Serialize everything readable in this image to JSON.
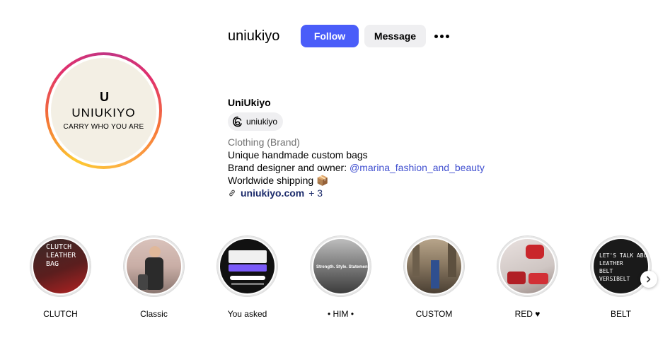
{
  "profile": {
    "username": "uniukiyo",
    "follow_label": "Follow",
    "message_label": "Message",
    "more_icon": "more-options-icon",
    "full_name": "UniUkiyo",
    "threads_handle": "uniukiyo",
    "category": "Clothing (Brand)",
    "bio_line1": "Unique handmade custom bags",
    "bio_line2_prefix": "Brand designer and owner: ",
    "bio_mention": "@marina_fashion_and_beauty",
    "bio_line3": "Worldwide shipping 📦",
    "link_text": "uniukiyo.com",
    "link_more": "+ 3"
  },
  "avatar": {
    "mark": "U",
    "name": "UNIUKIYO",
    "tagline": "CARRY WHO YOU ARE"
  },
  "highlights": [
    {
      "label": "CLUTCH",
      "overlay": "CLUTCH\nLEATHER\nBAG"
    },
    {
      "label": "Classic",
      "overlay": ""
    },
    {
      "label": "You asked",
      "overlay": ""
    },
    {
      "label": "• HIM •",
      "overlay": "Strength. Style. Statement."
    },
    {
      "label": "CUSTOM",
      "overlay": ""
    },
    {
      "label": "RED ♥",
      "overlay": ""
    },
    {
      "label": "BELT",
      "overlay": "LET'S TALK ABOUT OUR\nLEATHER\nBELT\nVERSIBELT"
    }
  ],
  "colors": {
    "follow_bg": "#4a5df9",
    "message_bg": "#efeff1",
    "mention": "#4150d0"
  }
}
